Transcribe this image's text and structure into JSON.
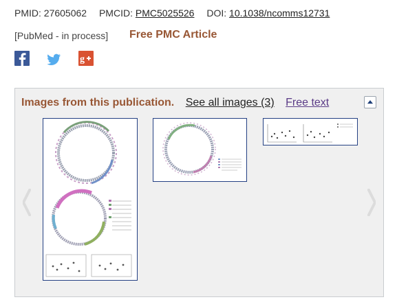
{
  "ids": {
    "pmid_label": "PMID: 27605062",
    "pmcid_label": "PMCID:",
    "pmcid": "PMC5025526",
    "doi_label": "DOI:",
    "doi": "10.1038/ncomms12731"
  },
  "status": "[PubMed - in process]",
  "free_pmc_label": "Free PMC Article",
  "social": {
    "facebook_icon": "facebook-icon",
    "twitter_icon": "twitter-icon",
    "googleplus_icon": "google-plus-icon"
  },
  "images_panel": {
    "title": "Images from this publication.",
    "see_all_label": "See all images (3)",
    "free_text_label": "Free text",
    "thumbnails": [
      "figure-1-thumbnail",
      "figure-2-thumbnail",
      "figure-3-thumbnail"
    ]
  },
  "colors": {
    "accent_brown": "#985735",
    "free_text_purple": "#5a3a86",
    "thumb_border": "#233f82",
    "panel_bg": "#f0f0f0"
  }
}
